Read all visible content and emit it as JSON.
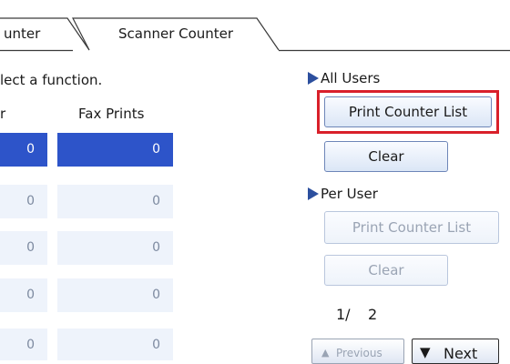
{
  "tabs": [
    {
      "label": "unter"
    },
    {
      "label": "Scanner Counter"
    }
  ],
  "instruction": "lect a function.",
  "columns": {
    "left_partial": "r",
    "fax_prints": "Fax Prints"
  },
  "rows": [
    {
      "left": "0",
      "fax": "0"
    },
    {
      "left": "0",
      "fax": "0"
    },
    {
      "left": "0",
      "fax": "0"
    },
    {
      "left": "0",
      "fax": "0"
    },
    {
      "left": "0",
      "fax": "0"
    }
  ],
  "all_users": {
    "label": "All Users",
    "print_list": "Print Counter List",
    "clear": "Clear"
  },
  "per_user": {
    "label": "Per User",
    "print_list": "Print Counter List",
    "clear": "Clear"
  },
  "pagination": {
    "current": "1/",
    "total": "2",
    "previous": "Previous",
    "next": "Next"
  },
  "colors": {
    "selected_row": "#2d54c9",
    "highlight": "#d9202a"
  }
}
